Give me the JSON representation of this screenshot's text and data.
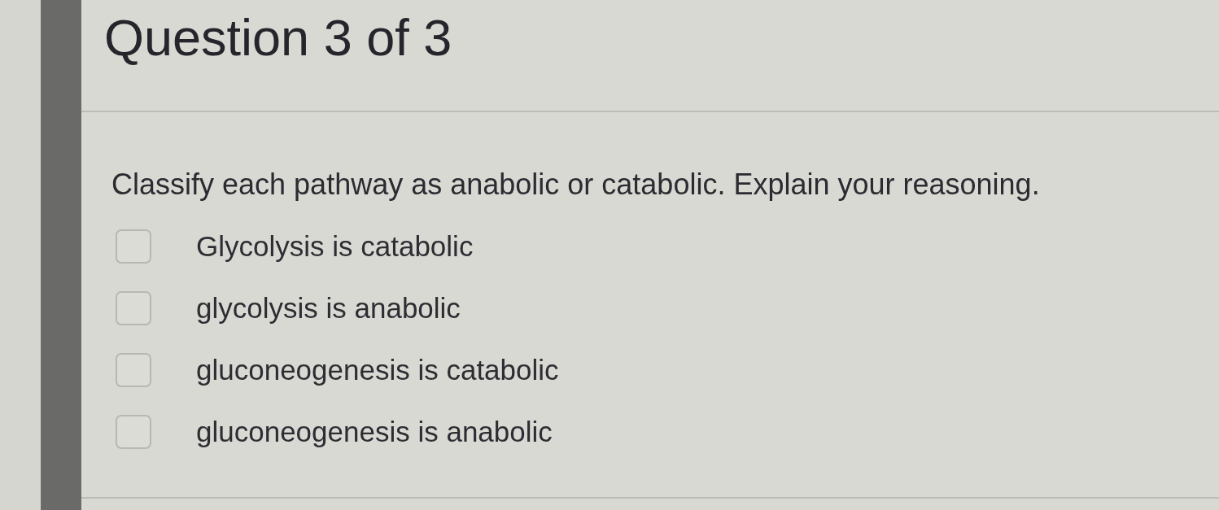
{
  "question": {
    "title": "Question 3 of 3",
    "prompt": "Classify each pathway as anabolic or catabolic. Explain your reasoning.",
    "options": [
      {
        "label": "Glycolysis is catabolic",
        "checked": false
      },
      {
        "label": "glycolysis is anabolic",
        "checked": false
      },
      {
        "label": "gluconeogenesis is catabolic",
        "checked": false
      },
      {
        "label": "gluconeogenesis is anabolic",
        "checked": false
      }
    ]
  }
}
